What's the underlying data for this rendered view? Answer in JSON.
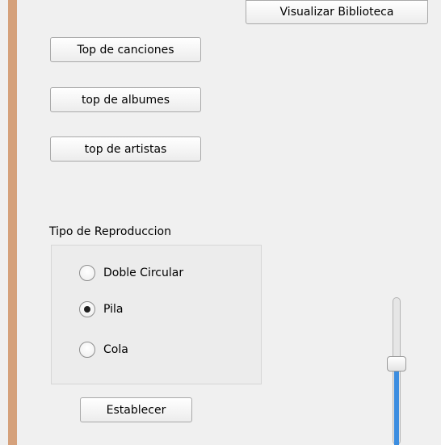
{
  "buttons": {
    "visualizar": "Visualizar Biblioteca",
    "top_canciones": "Top de canciones",
    "top_albumes": "top de albumes",
    "top_artistas": "top de artistas",
    "establecer": "Establecer"
  },
  "playback_group": {
    "title": "Tipo de Reproduccion",
    "options": [
      {
        "label": "Doble Circular",
        "checked": false
      },
      {
        "label": "Pila",
        "checked": true
      },
      {
        "label": "Cola",
        "checked": false
      }
    ]
  },
  "slider": {
    "level_fraction": 0.55
  },
  "colors": {
    "side_stripe": "#d5a17b",
    "slider_fill": "#3b8de0",
    "background": "#f0f0f0"
  }
}
